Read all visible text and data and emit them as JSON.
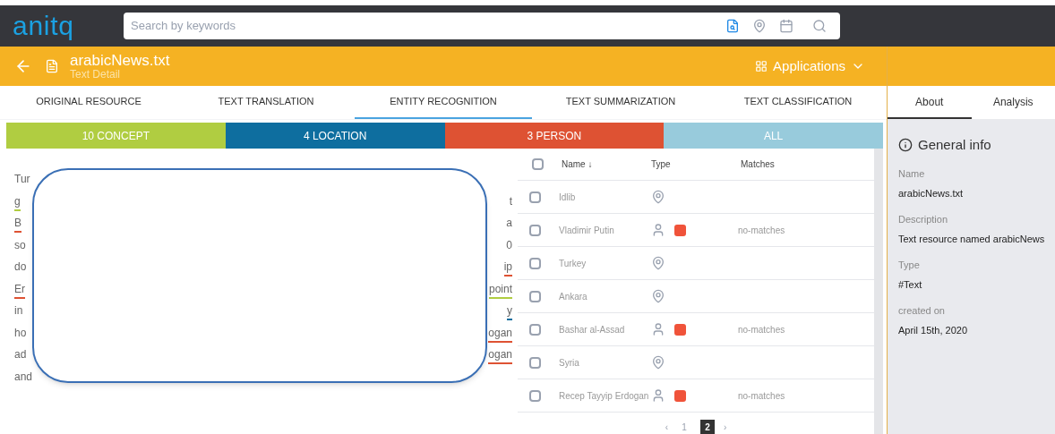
{
  "logo": "anitq",
  "search": {
    "placeholder": "Search by keywords"
  },
  "header": {
    "title": "arabicNews.txt",
    "subtitle": "Text Detail",
    "apps_button": "Applications"
  },
  "tabs": [
    {
      "label": "ORIGINAL RESOURCE",
      "selected": false
    },
    {
      "label": "TEXT TRANSLATION",
      "selected": false
    },
    {
      "label": "ENTITY RECOGNITION",
      "selected": true
    },
    {
      "label": "TEXT SUMMARIZATION",
      "selected": false
    },
    {
      "label": "TEXT CLASSIFICATION",
      "selected": false
    }
  ],
  "categories": [
    {
      "label": "10 CONCEPT",
      "color": "#b0cd41"
    },
    {
      "label": "4 LOCATION",
      "color": "#0e6e9f"
    },
    {
      "label": "3 PERSON",
      "color": "#de5233"
    },
    {
      "label": "ALL",
      "color": "#98cbdc"
    }
  ],
  "text_lines": [
    {
      "left": {
        "text": "Tur"
      }
    },
    {
      "left": {
        "text": "g",
        "color": "#b0cd41"
      },
      "right": {
        "text": "t"
      }
    },
    {
      "left": {
        "text": "B",
        "color": "#de5233"
      },
      "right": {
        "text": "a"
      }
    },
    {
      "left": {
        "text": "so"
      },
      "right": {
        "text": "0"
      }
    },
    {
      "left": {
        "text": "do"
      },
      "right": {
        "text": "ip",
        "color": "#de5233"
      }
    },
    {
      "left": {
        "text": "Er",
        "color": "#de5233"
      },
      "right": {
        "text": "point",
        "color": "#b0cd41"
      }
    },
    {
      "left": {
        "text": "in"
      },
      "right": {
        "text": "y",
        "color": "#0e6e9f"
      }
    },
    {
      "left": {
        "text": "ho"
      },
      "right": {
        "text": "ogan",
        "color": "#de5233"
      }
    },
    {
      "left": {
        "text": "ad"
      },
      "right": {
        "text": "ogan",
        "color": "#de5233"
      }
    },
    {
      "left": {
        "text": "and"
      }
    }
  ],
  "table": {
    "columns": [
      "Name ↓",
      "Type",
      "Matches"
    ],
    "all_checked": false,
    "rows": [
      {
        "name": "Idlib",
        "kind": "location",
        "checked": false
      },
      {
        "name": "Vladimir Putin",
        "kind": "person",
        "color": "#f0533a",
        "matches": "no-matches",
        "checked": false
      },
      {
        "name": "Turkey",
        "kind": "location",
        "checked": false
      },
      {
        "name": "Ankara",
        "kind": "location",
        "checked": false
      },
      {
        "name": "Bashar al-Assad",
        "kind": "person",
        "color": "#f0533a",
        "matches": "no-matches",
        "checked": false
      },
      {
        "name": "Syria",
        "kind": "location",
        "checked": false
      },
      {
        "name": "Recep Tayyip Erdogan",
        "kind": "person",
        "color": "#f0533a",
        "matches": "no-matches",
        "checked": false
      }
    ],
    "pagination": {
      "prev": "‹",
      "pages": [
        {
          "label": "1",
          "selected": false
        },
        {
          "label": "2",
          "selected": true
        }
      ],
      "next": "›"
    }
  },
  "side_tabs": [
    {
      "label": "About",
      "selected": true
    },
    {
      "label": "Analysis",
      "selected": false
    }
  ],
  "general_info": {
    "title": "General info",
    "fields": [
      {
        "label": "Name",
        "value": "arabicNews.txt"
      },
      {
        "label": "Description",
        "value": "Text resource named arabicNews"
      },
      {
        "label": "Type",
        "value": "#Text"
      },
      {
        "label": "created on",
        "value": "April 15th, 2020"
      }
    ]
  }
}
